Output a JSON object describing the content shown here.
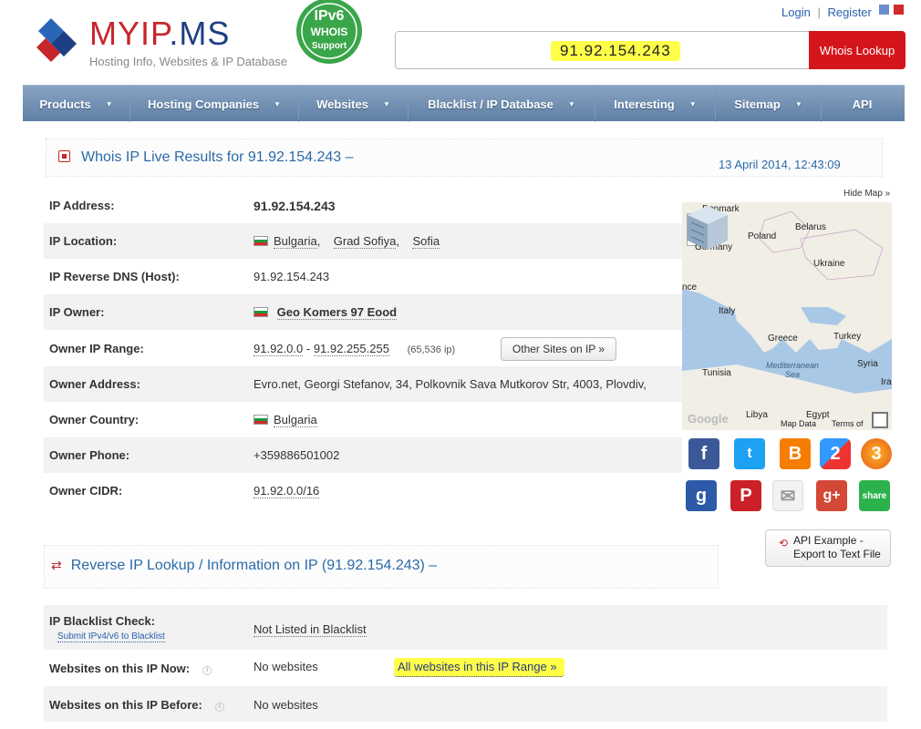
{
  "brand": {
    "name_red": "MYIP",
    "name_blue": ".MS",
    "tagline": "Hosting Info, Websites & IP Database",
    "badge_lines": [
      "IPv6",
      "WHOIS",
      "Support"
    ]
  },
  "toplinks": {
    "login": "Login",
    "sep": "|",
    "register": "Register"
  },
  "search": {
    "value": "91.92.154.243",
    "button": "Whois Lookup"
  },
  "nav": [
    {
      "label": "Products",
      "caret": "▼"
    },
    {
      "label": "Hosting Companies",
      "caret": "▼"
    },
    {
      "label": "Websites",
      "caret": "▼"
    },
    {
      "label": "Blacklist / IP Database",
      "caret": "▼"
    },
    {
      "label": "Interesting",
      "caret": "▼"
    },
    {
      "label": "Sitemap",
      "caret": "▼"
    },
    {
      "label": "API",
      "caret": ""
    }
  ],
  "whois": {
    "title": "Whois IP Live Results for 91.92.154.243 –",
    "date": "13 April 2014, 12:43:09",
    "hide_map": "Hide Map »",
    "rows": {
      "ip_address": {
        "label": "IP Address:",
        "value": "91.92.154.243"
      },
      "ip_location": {
        "label": "IP Location:",
        "country": "Bulgaria",
        "region": "Grad Sofiya",
        "city": "Sofia"
      },
      "reverse_dns": {
        "label": "IP Reverse DNS (Host):",
        "value": "91.92.154.243"
      },
      "ip_owner": {
        "label": "IP Owner:",
        "value": "Geo Komers 97 Eood"
      },
      "owner_range": {
        "label": "Owner IP Range:",
        "from": "91.92.0.0",
        "dash": "-",
        "to": "91.92.255.255",
        "count": "(65,536 ip)",
        "button": "Other Sites on IP »"
      },
      "owner_address": {
        "label": "Owner Address:",
        "value": "Evro.net, Georgi Stefanov, 34, Polkovnik Sava Mutkorov Str, 4003, Plovdiv,"
      },
      "owner_country": {
        "label": "Owner Country:",
        "value": "Bulgaria"
      },
      "owner_phone": {
        "label": "Owner Phone:",
        "value": "+359886501002"
      },
      "owner_cidr": {
        "label": "Owner CIDR:",
        "value": "91.92.0.0/16"
      }
    }
  },
  "map": {
    "zoom_in": "+",
    "zoom_out": "−",
    "labels": [
      "Denmark",
      "Belarus",
      "Poland",
      "Germany",
      "Ukraine",
      "nce",
      "Italy",
      "Greece",
      "Turkey",
      "Tunisia",
      "Syria",
      "Libya",
      "Egypt",
      "Iraq"
    ],
    "sea": "Mediterranean Sea",
    "footer": [
      "Map Data",
      "Terms of",
      "Google"
    ]
  },
  "social": [
    "f",
    "t",
    "B",
    "2",
    "3",
    "g",
    "P",
    "✉",
    "g+",
    "share"
  ],
  "api_button": {
    "line1": "API Example -",
    "line2": "Export to Text File"
  },
  "reverse": {
    "title": "Reverse IP Lookup / Information on IP (91.92.154.243) –",
    "rows": {
      "blacklist": {
        "label": "IP Blacklist Check:",
        "sub": "Submit IPv4/v6 to Blacklist",
        "value": "Not Listed in Blacklist"
      },
      "now": {
        "label": "Websites on this IP Now:",
        "value": "No websites",
        "link": "All websites in this IP Range »"
      },
      "before": {
        "label": "Websites on this IP Before:",
        "value": "No websites"
      }
    }
  }
}
